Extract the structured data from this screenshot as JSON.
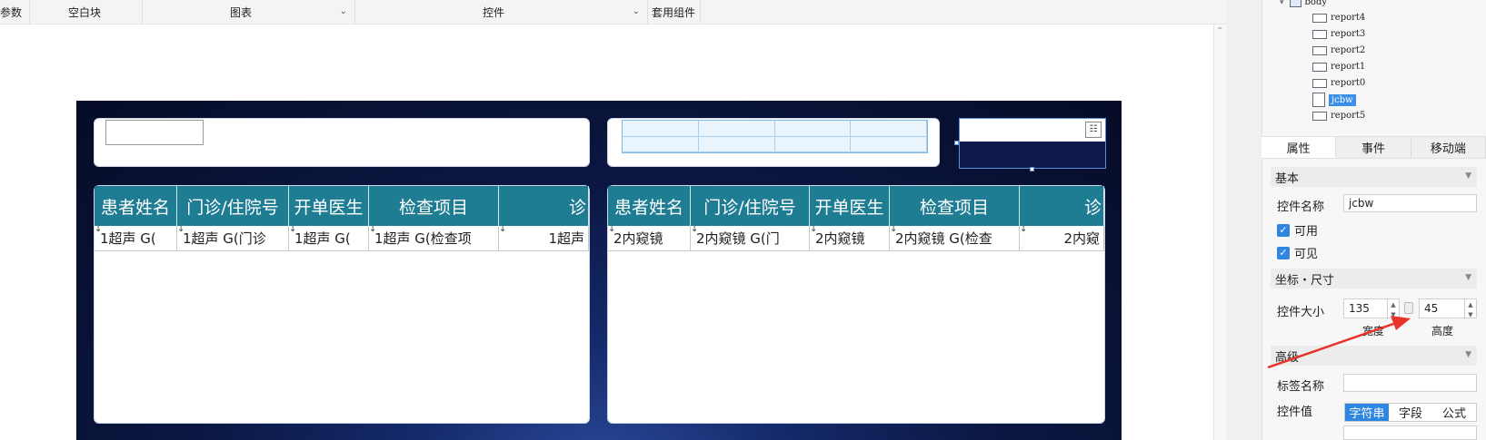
{
  "toolbar": {
    "items": [
      {
        "label": "参数"
      },
      {
        "label": "空白块"
      },
      {
        "label": "图表"
      },
      {
        "label": "控件"
      },
      {
        "label": "套用组件"
      }
    ]
  },
  "canvas": {
    "left_table": {
      "headers": [
        "患者姓名",
        "门诊/住院号",
        "开单医生",
        "检查项目",
        "诊"
      ],
      "row": [
        "1超声 G(",
        "1超声 G(门诊",
        "1超声 G(",
        "1超声 G(检查项",
        "1超声"
      ]
    },
    "right_table": {
      "headers": [
        "患者姓名",
        "门诊/住院号",
        "开单医生",
        "检查项目",
        "诊"
      ],
      "row": [
        "2内窥镜",
        "2内窥镜 G(门",
        "2内窥镜",
        "2内窥镜 G(检查",
        "2内窥"
      ]
    },
    "widget_icon": "calendar-widget-icon"
  },
  "tree": {
    "root": "body",
    "items": [
      "report4",
      "report3",
      "report2",
      "report1",
      "report0",
      "jcbw",
      "report5"
    ],
    "selected": "jcbw"
  },
  "props": {
    "tabs": [
      "属性",
      "事件",
      "移动端"
    ],
    "active_tab": "属性",
    "sections": {
      "basic": "基本",
      "coord": "坐标・尺寸",
      "advanced": "高级"
    },
    "name_label": "控件名称",
    "name_value": "jcbw",
    "enabled_label": "可用",
    "visible_label": "可见",
    "size_label": "控件大小",
    "width_value": "135",
    "height_value": "45",
    "width_caption": "宽度",
    "height_caption": "高度",
    "tag_label": "标签名称",
    "tag_value": "",
    "value_label": "控件值",
    "value_modes": [
      "字符串",
      "字段",
      "公式"
    ],
    "active_mode": "字符串"
  },
  "colors": {
    "table_header": "#1f7d93",
    "selection": "#3b8fe8",
    "annotation_arrow": "#e8322a"
  }
}
